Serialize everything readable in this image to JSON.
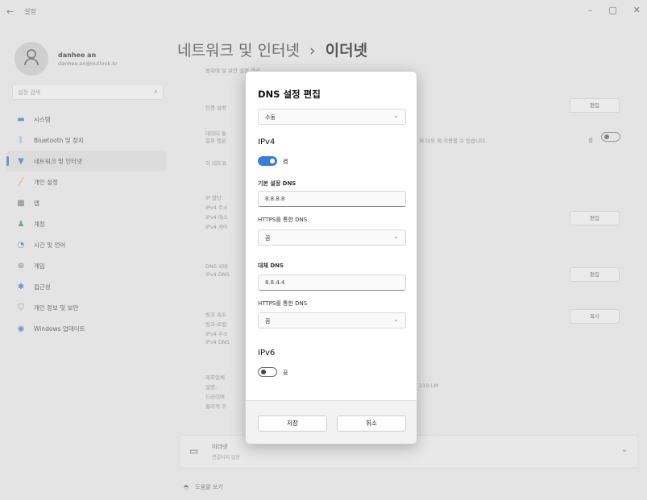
{
  "window": {
    "title": "설정",
    "back_glyph": "←",
    "controls": [
      "–",
      "▢",
      "✕"
    ]
  },
  "user": {
    "name": "danhee an",
    "email": "danhee.an@outlook.kr"
  },
  "search": {
    "placeholder": "설정 검색"
  },
  "nav": [
    {
      "label": "시스템",
      "icon": "monitor-icon"
    },
    {
      "label": "Bluetooth 및 장치",
      "icon": "bluetooth-icon"
    },
    {
      "label": "네트워크 및 인터넷",
      "icon": "wifi-icon",
      "active": true
    },
    {
      "label": "개인 설정",
      "icon": "brush-icon"
    },
    {
      "label": "앱",
      "icon": "apps-icon"
    },
    {
      "label": "계정",
      "icon": "person-icon"
    },
    {
      "label": "시간 및 언어",
      "icon": "globe-clock-icon"
    },
    {
      "label": "게임",
      "icon": "gamepad-icon"
    },
    {
      "label": "접근성",
      "icon": "accessibility-icon"
    },
    {
      "label": "개인 정보 및 보안",
      "icon": "shield-icon"
    },
    {
      "label": "Windows 업데이트",
      "icon": "update-icon"
    }
  ],
  "header": {
    "breadcrumb_parent": "네트워크 및 인터넷",
    "separator": "›",
    "breadcrumb_current": "이더넷"
  },
  "background": {
    "row_top": "범위에 및 보안 설정 관리",
    "auth_label": "인증 설정",
    "metered_label": "데이터 통",
    "metered_desc": "일부 앱은",
    "metered_note": "제 더욱 제 적용할 수 있습니다.",
    "network_label": "이 네트워",
    "ip_assign": "IP 할당:",
    "ipv4_addr": "IPv4 주소",
    "ipv4_mask": "IPv4 마스",
    "ipv4_gw": "IPv4 게이",
    "dns_assign": "DNS 서버",
    "ipv4_dns": "IPv4 DNS",
    "link_speed": "링크 속도",
    "link_local": "링크-로컬",
    "ipv4_addr2": "IPv4 주소",
    "ipv4_dns2": "IPv4 DNS",
    "manufacturer": "제조업체",
    "description": "설명:",
    "description_value": "219-LM",
    "driver": "드라이버",
    "physical": "물리적 주",
    "edit_label": "편집",
    "copy_label": "복사",
    "off_label": "끔",
    "ethernet_title": "이더넷",
    "ethernet_sub": "연결되지 않음",
    "help_label": "도움말 보기"
  },
  "dialog": {
    "title": "DNS 설정 편집",
    "mode": "수동",
    "ipv4": {
      "title": "IPv4",
      "toggle_label": "켬",
      "toggle_on": true,
      "preferred_label": "기본 설정 DNS",
      "preferred_value": "8.8.8.8",
      "https_label": "HTTPS를 통한 DNS",
      "https_value": "끔",
      "alternate_label": "대체 DNS",
      "alternate_value": "8.8.4.4",
      "https2_label": "HTTPS를 통한 DNS",
      "https2_value": "끔"
    },
    "ipv6": {
      "title": "IPv6",
      "toggle_label": "끔",
      "toggle_on": false
    },
    "save_label": "저장",
    "cancel_label": "취소"
  }
}
